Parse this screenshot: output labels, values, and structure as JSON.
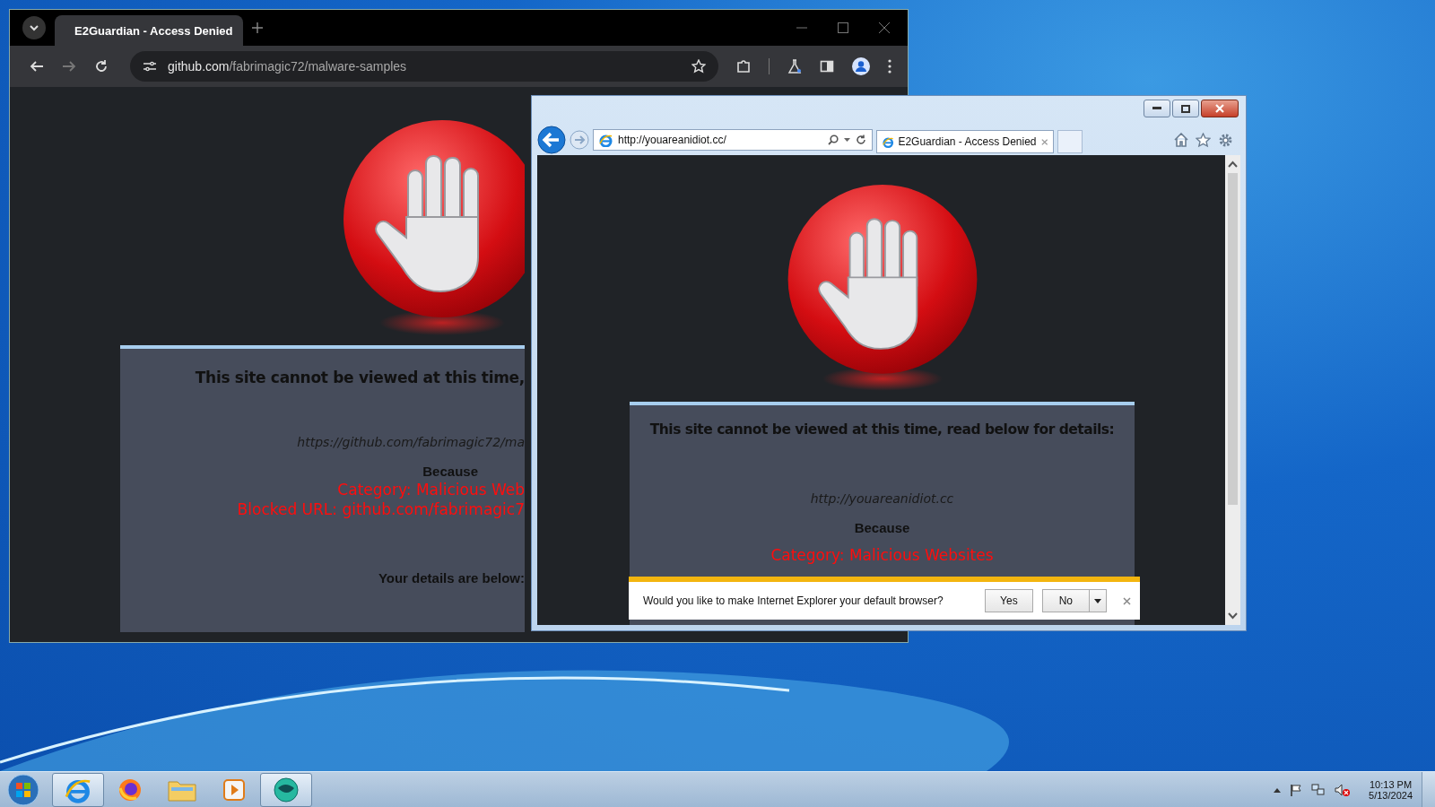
{
  "chrome_window": {
    "tabs": [
      {
        "title": "E2Guardian - Access Denied",
        "selected": true
      }
    ],
    "address": {
      "host": "github.com",
      "path": "/fabrimagic72/malware-samples"
    },
    "page": {
      "lines": [
        {
          "kind": "heading",
          "text": "This site cannot be viewed at this time,"
        },
        {
          "kind": "url",
          "text": "https://github.com/fabrimagic72/ma"
        },
        {
          "kind": "label",
          "text": "Because"
        },
        {
          "kind": "alert",
          "text": "Category: Malicious Web"
        },
        {
          "kind": "alert",
          "text": "Blocked URL: github.com/fabrimagic7"
        },
        {
          "kind": "details",
          "text": "Your details are below:"
        }
      ]
    }
  },
  "ie_window": {
    "address": "http://youareanidiot.cc/",
    "tabs": [
      {
        "title": "E2Guardian - Access Denied",
        "selected": true
      }
    ],
    "page": {
      "lines": [
        {
          "kind": "heading",
          "text": "This site cannot be viewed at this time, read below for details:"
        },
        {
          "kind": "url",
          "text": "http://youareanidiot.cc"
        },
        {
          "kind": "label",
          "text": "Because"
        },
        {
          "kind": "alert",
          "text": "Category: Malicious Websites"
        }
      ]
    },
    "notification": {
      "message": "Would you like to make Internet Explorer your default browser?",
      "buttons": [
        "Yes",
        "No"
      ]
    }
  },
  "taskbar": {
    "apps": [
      {
        "kind": "ie",
        "running": true
      },
      {
        "kind": "firefox",
        "running": false
      },
      {
        "kind": "folder",
        "running": false
      },
      {
        "kind": "media",
        "running": false
      },
      {
        "kind": "globe",
        "running": true
      }
    ]
  },
  "clock": {
    "time": "10:13 PM",
    "date": "5/13/2024"
  }
}
